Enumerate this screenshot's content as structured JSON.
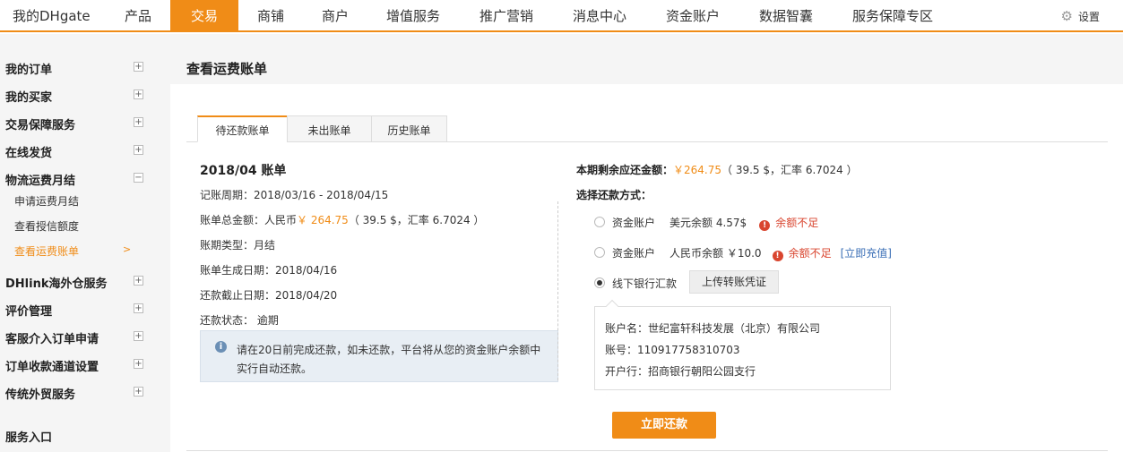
{
  "topnav": {
    "items": [
      "我的DHgate",
      "产品",
      "交易",
      "商铺",
      "商户",
      "增值服务",
      "推广营销",
      "消息中心",
      "资金账户",
      "数据智囊",
      "服务保障专区"
    ],
    "active_index": 2,
    "settings_label": "设置",
    "accent_color": "#f08c17"
  },
  "sidebar": {
    "sections": [
      {
        "label": "我的订单",
        "toggle": "+"
      },
      {
        "label": "我的买家",
        "toggle": "+"
      },
      {
        "label": "交易保障服务",
        "toggle": "+"
      },
      {
        "label": "在线发货",
        "toggle": "+"
      },
      {
        "label": "物流运费月结",
        "toggle": "−"
      },
      {
        "label": "DHlink海外仓服务",
        "toggle": "+"
      },
      {
        "label": "评价管理",
        "toggle": "+"
      },
      {
        "label": "客服介入订单申请",
        "toggle": "+"
      },
      {
        "label": "订单收款通道设置",
        "toggle": "+"
      },
      {
        "label": "传统外贸服务",
        "toggle": "+"
      }
    ],
    "subitems": [
      {
        "label": "申请运费月结"
      },
      {
        "label": "查看授信额度"
      },
      {
        "label": "查看运费账单",
        "active": true
      }
    ],
    "active_arrow": ">",
    "service_entry": "服务入口"
  },
  "page": {
    "title": "查看运费账单",
    "tabs": [
      "待还款账单",
      "未出账单",
      "历史账单"
    ]
  },
  "bill": {
    "title": "2018/04 账单",
    "period_label": "记账周期：",
    "period": "2018/03/16 - 2018/04/15",
    "total_label": "账单总金额：人民币",
    "total_amount": "￥ 264.75",
    "total_note": "（ 39.5 $，汇率 6.7024 ）",
    "type_label": "账期类型：",
    "type": "月结",
    "created_label": "账单生成日期：",
    "created": "2018/04/16",
    "due_label": "还款截止日期：",
    "due": "2018/04/20",
    "status_label": "还款状态：",
    "status": "逾期",
    "notice": "请在20日前完成还款，如未还款，平台将从您的资金账户余额中实行自动还款。"
  },
  "payment": {
    "remaining_label": "本期剩余应还金额：",
    "remaining_amount": "￥264.75",
    "remaining_note": "（ 39.5 $，汇率 6.7024 ）",
    "method_label": "选择还款方式：",
    "opt1_name": "资金账户",
    "opt1_balance": "美元余额 4.57$",
    "opt2_name": "资金账户",
    "opt2_balance": "人民币余额 ￥10.0",
    "insufficient": "余额不足",
    "recharge_link": "[立即充值]",
    "opt3_name": "线下银行汇款",
    "upload_button": "上传转账凭证",
    "bank_account_name": "账户名：世纪富轩科技发展（北京）有限公司",
    "bank_account_no": "账号：110917758310703",
    "bank_branch": "开户行：招商银行朝阳公园支行",
    "pay_button": "立即还款"
  }
}
